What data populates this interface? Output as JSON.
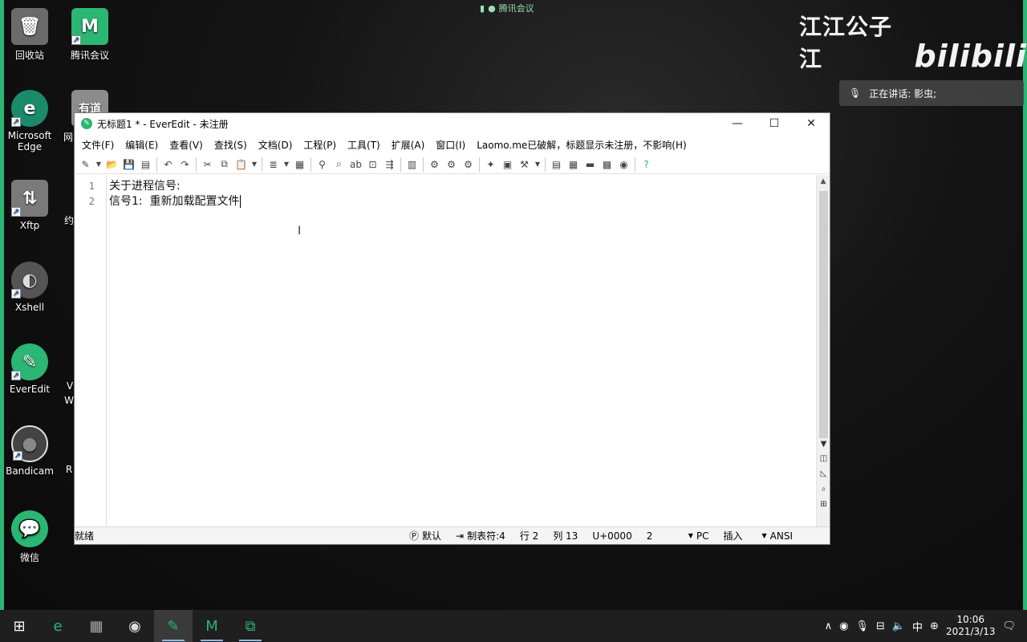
{
  "desktop": {
    "icons": [
      {
        "label": "回收站",
        "glyph": "🗑"
      },
      {
        "label": "腾讯会议",
        "glyph": "M"
      },
      {
        "label": "Microsoft Edge",
        "glyph": "e"
      },
      {
        "label": "有道",
        "glyph": "有道"
      },
      {
        "label": "Xftp",
        "glyph": "⇅"
      },
      {
        "label": "Xshell",
        "glyph": "◐"
      },
      {
        "label": "EverEdit",
        "glyph": "✎"
      },
      {
        "label": "Bandicam",
        "glyph": "●"
      },
      {
        "label": "微信",
        "glyph": "💬"
      }
    ],
    "partial_labels": [
      "网",
      "约",
      "V",
      "W",
      "R"
    ]
  },
  "meeting": {
    "top_label": "腾讯会议",
    "speaker_text": "正在讲话: 影虫;"
  },
  "watermark": {
    "channel": "江江公子江",
    "site": "bilibili"
  },
  "window": {
    "title": "无标题1 * - EverEdit - 未注册",
    "menu": [
      "文件(F)",
      "编辑(E)",
      "查看(V)",
      "查找(S)",
      "文档(D)",
      "工程(P)",
      "工具(T)",
      "扩展(A)",
      "窗口(I)",
      "Laomo.me已破解，标题显示未注册，不影响(H)"
    ],
    "line_numbers": [
      "1",
      "2"
    ],
    "lines": [
      "关于进程信号:",
      "信号1:  重新加载配置文件"
    ],
    "status": {
      "ready": "就绪",
      "encoding_mode": "默认",
      "tab": "制表符:4",
      "row": "行 2",
      "col": "列 13",
      "unicode": "U+0000",
      "num": "2",
      "line_end": "PC",
      "insert": "插入",
      "charset": "ANSI"
    }
  },
  "taskbar": {
    "tray_ime": "中",
    "time": "10:06",
    "date": "2021/3/13"
  }
}
